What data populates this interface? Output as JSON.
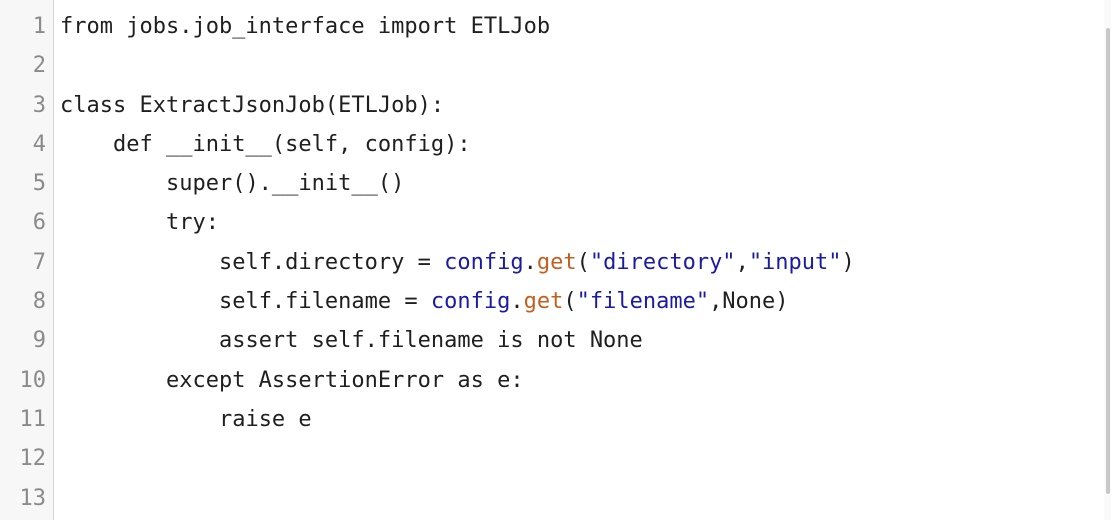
{
  "editor": {
    "lines": [
      {
        "num": "1",
        "indent": "",
        "segments": [
          {
            "t": "from jobs.job_interface import ETLJob",
            "k": "plain"
          }
        ]
      },
      {
        "num": "2",
        "indent": "",
        "segments": []
      },
      {
        "num": "3",
        "indent": "",
        "segments": [
          {
            "t": "class ExtractJsonJob(ETLJob):",
            "k": "plain"
          }
        ]
      },
      {
        "num": "4",
        "indent": "    ",
        "segments": [
          {
            "t": "def __init__(self, config):",
            "k": "plain"
          }
        ]
      },
      {
        "num": "5",
        "indent": "        ",
        "segments": [
          {
            "t": "super().__init__()",
            "k": "plain"
          }
        ]
      },
      {
        "num": "6",
        "indent": "        ",
        "segments": [
          {
            "t": "try:",
            "k": "plain"
          }
        ]
      },
      {
        "num": "7",
        "indent": "            ",
        "segments": [
          {
            "t": "self.directory = ",
            "k": "plain"
          },
          {
            "t": "config",
            "k": "obj"
          },
          {
            "t": ".",
            "k": "plain"
          },
          {
            "t": "get",
            "k": "fn"
          },
          {
            "t": "(",
            "k": "plain"
          },
          {
            "t": "\"directory\"",
            "k": "str"
          },
          {
            "t": ",",
            "k": "plain"
          },
          {
            "t": "\"input\"",
            "k": "str"
          },
          {
            "t": ")",
            "k": "plain"
          }
        ]
      },
      {
        "num": "8",
        "indent": "            ",
        "segments": [
          {
            "t": "self.filename = ",
            "k": "plain"
          },
          {
            "t": "config",
            "k": "obj"
          },
          {
            "t": ".",
            "k": "plain"
          },
          {
            "t": "get",
            "k": "fn"
          },
          {
            "t": "(",
            "k": "plain"
          },
          {
            "t": "\"filename\"",
            "k": "str"
          },
          {
            "t": ",None)",
            "k": "plain"
          }
        ]
      },
      {
        "num": "9",
        "indent": "            ",
        "segments": [
          {
            "t": "assert self.filename is not None",
            "k": "plain"
          }
        ]
      },
      {
        "num": "10",
        "indent": "        ",
        "segments": [
          {
            "t": "except AssertionError as e:",
            "k": "plain"
          }
        ]
      },
      {
        "num": "11",
        "indent": "            ",
        "segments": [
          {
            "t": "raise e",
            "k": "plain"
          }
        ]
      },
      {
        "num": "12",
        "indent": "",
        "segments": []
      },
      {
        "num": "13",
        "indent": "",
        "segments": []
      }
    ]
  },
  "colors": {
    "keyword_fn": "#c4601f",
    "object": "#1a1aa6",
    "string": "#1a1aa6",
    "text": "#1f1f1f",
    "line_number": "#8a8a8a",
    "gutter_bg": "#f7f7f7"
  }
}
